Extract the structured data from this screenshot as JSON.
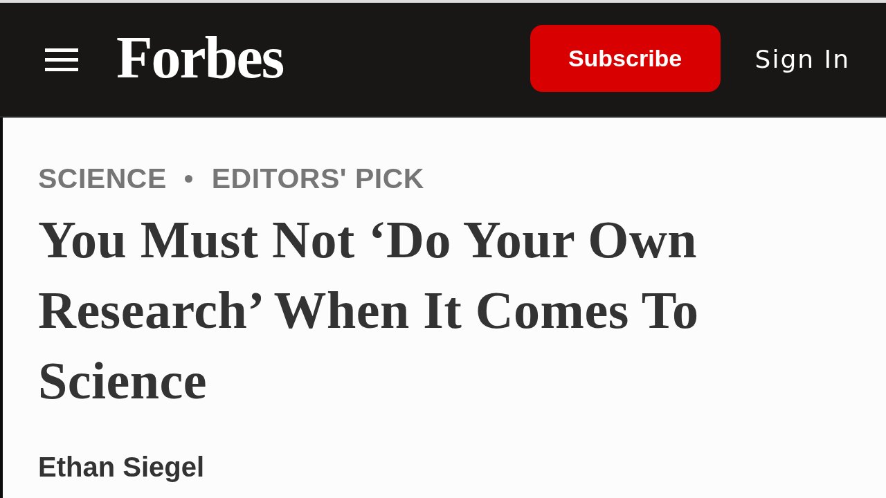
{
  "header": {
    "logo": "Forbes",
    "subscribe_button": "Subscribe",
    "sign_in_link": "Sign In"
  },
  "article": {
    "tags": [
      "SCIENCE",
      "EDITORS' PICK"
    ],
    "headline": "You Must Not ‘Do Your Own Research’ When It Comes To Science",
    "author": "Ethan Siegel"
  }
}
